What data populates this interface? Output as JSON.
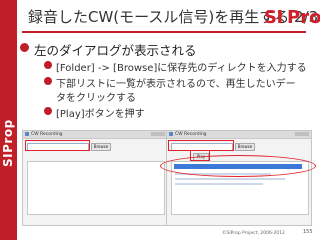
{
  "brand": {
    "side_text": "SIProp",
    "logo_text_1": "SI",
    "logo_text_2": "Prop"
  },
  "title": {
    "text": "録音したCW(モースル信号)を再生する",
    "number": "2/3"
  },
  "bullets": {
    "main": "左のダイアログが表示される",
    "sub1": "[Folder] -> [Browse]に保存先のディレクトを入力する",
    "sub2a": "下部リストに一覧が表示されるので、再生したいデー",
    "sub2b": "タをクリックする",
    "sub3": "[Play]ボタンを押す"
  },
  "screens": {
    "left_title": "CW Recording",
    "right_title": "CW Recording",
    "browse_label": "Browse",
    "play_label": "Play"
  },
  "footer": {
    "copyright": "©SIProp Project, 2006-2012",
    "page": "155"
  },
  "colors": {
    "accent": "#c01f28",
    "highlight": "#e0202a",
    "selection": "#3c78d8"
  }
}
